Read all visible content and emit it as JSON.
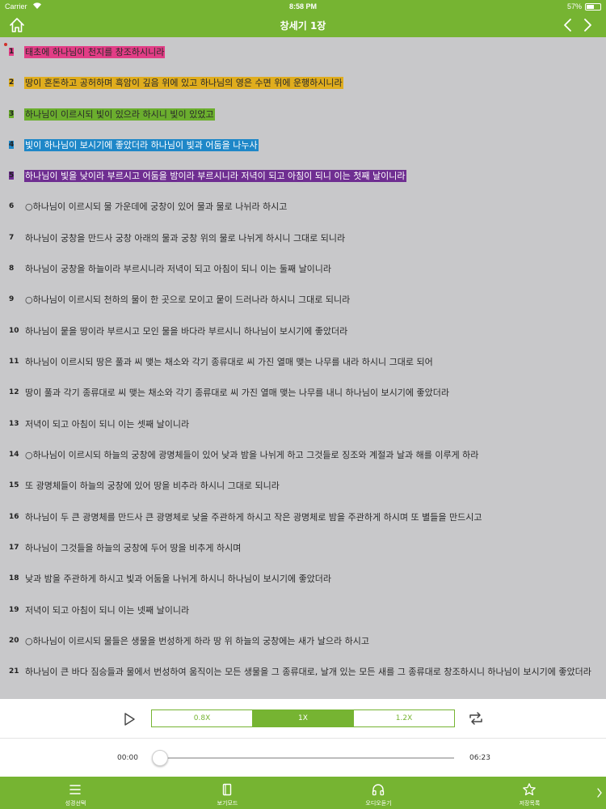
{
  "status": {
    "carrier": "Carrier",
    "time": "8:58 PM",
    "battery": "57%",
    "battery_level": 0.57
  },
  "nav": {
    "title": "창세기 1장"
  },
  "verses": [
    {
      "num": "1",
      "text": "태초에 하나님이 천지를 창조하시니라",
      "highlight": "pink"
    },
    {
      "num": "2",
      "text": "땅이 혼돈하고 공허하며 흑암이 깊음 위에 있고 하나님의 영은 수면 위에 운행하시니라",
      "highlight": "yellow"
    },
    {
      "num": "3",
      "text": "하나님이 이르시되 빛이 있으라 하시니 빛이 있었고",
      "highlight": "green"
    },
    {
      "num": "4",
      "text": "빛이 하나님이 보시기에 좋았더라 하나님이 빛과 어둠을 나누사",
      "highlight": "blue"
    },
    {
      "num": "5",
      "text": "하나님이 빛을 낮이라 부르시고 어둠을 밤이라 부르시니라 저녁이 되고 아침이 되니 이는 첫째 날이니라",
      "highlight": "purple"
    },
    {
      "num": "6",
      "text": "○하나님이 이르시되 물 가운데에 궁창이 있어 물과 물로 나뉘라 하시고",
      "highlight": ""
    },
    {
      "num": "7",
      "text": "하나님이 궁창을 만드사 궁창 아래의 물과 궁창 위의 물로 나뉘게 하시니 그대로 되니라",
      "highlight": ""
    },
    {
      "num": "8",
      "text": "하나님이 궁창을 하늘이라 부르시니라 저녁이 되고 아침이 되니 이는 둘째 날이니라",
      "highlight": ""
    },
    {
      "num": "9",
      "text": "○하나님이 이르시되 천하의 물이 한 곳으로 모이고 뭍이 드러나라 하시니 그대로 되니라",
      "highlight": ""
    },
    {
      "num": "10",
      "text": "하나님이 뭍을 땅이라 부르시고 모인 물을 바다라 부르시니 하나님이 보시기에 좋았더라",
      "highlight": ""
    },
    {
      "num": "11",
      "text": "하나님이 이르시되 땅은 풀과 씨 맺는 채소와 각기 종류대로 씨 가진 열매 맺는 나무를 내라 하시니 그대로 되어",
      "highlight": ""
    },
    {
      "num": "12",
      "text": "땅이 풀과 각기 종류대로 씨 맺는 채소와 각기 종류대로 씨 가진 열매 맺는 나무를 내니 하나님이 보시기에 좋았더라",
      "highlight": ""
    },
    {
      "num": "13",
      "text": "저녁이 되고 아침이 되니 이는 셋째 날이니라",
      "highlight": ""
    },
    {
      "num": "14",
      "text": "○하나님이 이르시되 하늘의 궁창에 광명체들이 있어 낮과 밤을 나뉘게 하고 그것들로 징조와 계절과 날과 해를 이루게 하라",
      "highlight": ""
    },
    {
      "num": "15",
      "text": "또 광명체들이 하늘의 궁창에 있어 땅을 비추라 하시니 그대로 되니라",
      "highlight": ""
    },
    {
      "num": "16",
      "text": "하나님이 두 큰 광명체를 만드사 큰 광명체로 낮을 주관하게 하시고 작은 광명체로 밤을 주관하게 하시며 또 별들을 만드시고",
      "highlight": ""
    },
    {
      "num": "17",
      "text": "하나님이 그것들을 하늘의 궁창에 두어 땅을 비추게 하시며",
      "highlight": ""
    },
    {
      "num": "18",
      "text": "낮과 밤을 주관하게 하시고 빛과 어둠을 나뉘게 하시니 하나님이 보시기에 좋았더라",
      "highlight": ""
    },
    {
      "num": "19",
      "text": "저녁이 되고 아침이 되니 이는 넷째 날이니라",
      "highlight": ""
    },
    {
      "num": "20",
      "text": "○하나님이 이르시되 물들은 생물을 번성하게 하라 땅 위 하늘의 궁창에는 새가 날으라 하시고",
      "highlight": ""
    },
    {
      "num": "21",
      "text": "하나님이 큰 바다 짐승들과 물에서 번성하여 움직이는 모든 생물을 그 종류대로, 날개 있는 모든 새를 그 종류대로 창조하시니 하나님이 보시기에 좋았더라",
      "highlight": ""
    }
  ],
  "player": {
    "speeds": [
      "0.8X",
      "1X",
      "1.2X"
    ],
    "active_speed": "1X",
    "time_current": "00:00",
    "time_total": "06:23",
    "progress": 0
  },
  "tabs": [
    {
      "label": "성경선택",
      "icon": "list-icon"
    },
    {
      "label": "보기모드",
      "icon": "book-icon"
    },
    {
      "label": "오디오듣기",
      "icon": "headphones-icon"
    },
    {
      "label": "저장목록",
      "icon": "star-icon"
    }
  ],
  "colors": {
    "accent": "#76b432",
    "highlight_pink": "#e23d86",
    "highlight_yellow": "#e0ad1d",
    "highlight_green": "#6bae2e",
    "highlight_blue": "#1e87c8",
    "highlight_purple": "#6f2e91",
    "page_background": "#c8c8ca"
  }
}
